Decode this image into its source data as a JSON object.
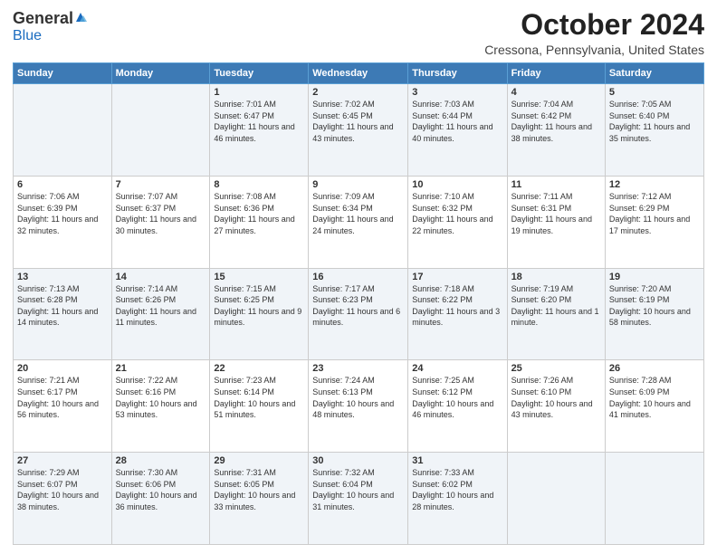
{
  "header": {
    "logo_general": "General",
    "logo_blue": "Blue",
    "main_title": "October 2024",
    "subtitle": "Cressona, Pennsylvania, United States"
  },
  "days_of_week": [
    "Sunday",
    "Monday",
    "Tuesday",
    "Wednesday",
    "Thursday",
    "Friday",
    "Saturday"
  ],
  "weeks": [
    [
      {
        "day": "",
        "sunrise": "",
        "sunset": "",
        "daylight": ""
      },
      {
        "day": "",
        "sunrise": "",
        "sunset": "",
        "daylight": ""
      },
      {
        "day": "1",
        "sunrise": "Sunrise: 7:01 AM",
        "sunset": "Sunset: 6:47 PM",
        "daylight": "Daylight: 11 hours and 46 minutes."
      },
      {
        "day": "2",
        "sunrise": "Sunrise: 7:02 AM",
        "sunset": "Sunset: 6:45 PM",
        "daylight": "Daylight: 11 hours and 43 minutes."
      },
      {
        "day": "3",
        "sunrise": "Sunrise: 7:03 AM",
        "sunset": "Sunset: 6:44 PM",
        "daylight": "Daylight: 11 hours and 40 minutes."
      },
      {
        "day": "4",
        "sunrise": "Sunrise: 7:04 AM",
        "sunset": "Sunset: 6:42 PM",
        "daylight": "Daylight: 11 hours and 38 minutes."
      },
      {
        "day": "5",
        "sunrise": "Sunrise: 7:05 AM",
        "sunset": "Sunset: 6:40 PM",
        "daylight": "Daylight: 11 hours and 35 minutes."
      }
    ],
    [
      {
        "day": "6",
        "sunrise": "Sunrise: 7:06 AM",
        "sunset": "Sunset: 6:39 PM",
        "daylight": "Daylight: 11 hours and 32 minutes."
      },
      {
        "day": "7",
        "sunrise": "Sunrise: 7:07 AM",
        "sunset": "Sunset: 6:37 PM",
        "daylight": "Daylight: 11 hours and 30 minutes."
      },
      {
        "day": "8",
        "sunrise": "Sunrise: 7:08 AM",
        "sunset": "Sunset: 6:36 PM",
        "daylight": "Daylight: 11 hours and 27 minutes."
      },
      {
        "day": "9",
        "sunrise": "Sunrise: 7:09 AM",
        "sunset": "Sunset: 6:34 PM",
        "daylight": "Daylight: 11 hours and 24 minutes."
      },
      {
        "day": "10",
        "sunrise": "Sunrise: 7:10 AM",
        "sunset": "Sunset: 6:32 PM",
        "daylight": "Daylight: 11 hours and 22 minutes."
      },
      {
        "day": "11",
        "sunrise": "Sunrise: 7:11 AM",
        "sunset": "Sunset: 6:31 PM",
        "daylight": "Daylight: 11 hours and 19 minutes."
      },
      {
        "day": "12",
        "sunrise": "Sunrise: 7:12 AM",
        "sunset": "Sunset: 6:29 PM",
        "daylight": "Daylight: 11 hours and 17 minutes."
      }
    ],
    [
      {
        "day": "13",
        "sunrise": "Sunrise: 7:13 AM",
        "sunset": "Sunset: 6:28 PM",
        "daylight": "Daylight: 11 hours and 14 minutes."
      },
      {
        "day": "14",
        "sunrise": "Sunrise: 7:14 AM",
        "sunset": "Sunset: 6:26 PM",
        "daylight": "Daylight: 11 hours and 11 minutes."
      },
      {
        "day": "15",
        "sunrise": "Sunrise: 7:15 AM",
        "sunset": "Sunset: 6:25 PM",
        "daylight": "Daylight: 11 hours and 9 minutes."
      },
      {
        "day": "16",
        "sunrise": "Sunrise: 7:17 AM",
        "sunset": "Sunset: 6:23 PM",
        "daylight": "Daylight: 11 hours and 6 minutes."
      },
      {
        "day": "17",
        "sunrise": "Sunrise: 7:18 AM",
        "sunset": "Sunset: 6:22 PM",
        "daylight": "Daylight: 11 hours and 3 minutes."
      },
      {
        "day": "18",
        "sunrise": "Sunrise: 7:19 AM",
        "sunset": "Sunset: 6:20 PM",
        "daylight": "Daylight: 11 hours and 1 minute."
      },
      {
        "day": "19",
        "sunrise": "Sunrise: 7:20 AM",
        "sunset": "Sunset: 6:19 PM",
        "daylight": "Daylight: 10 hours and 58 minutes."
      }
    ],
    [
      {
        "day": "20",
        "sunrise": "Sunrise: 7:21 AM",
        "sunset": "Sunset: 6:17 PM",
        "daylight": "Daylight: 10 hours and 56 minutes."
      },
      {
        "day": "21",
        "sunrise": "Sunrise: 7:22 AM",
        "sunset": "Sunset: 6:16 PM",
        "daylight": "Daylight: 10 hours and 53 minutes."
      },
      {
        "day": "22",
        "sunrise": "Sunrise: 7:23 AM",
        "sunset": "Sunset: 6:14 PM",
        "daylight": "Daylight: 10 hours and 51 minutes."
      },
      {
        "day": "23",
        "sunrise": "Sunrise: 7:24 AM",
        "sunset": "Sunset: 6:13 PM",
        "daylight": "Daylight: 10 hours and 48 minutes."
      },
      {
        "day": "24",
        "sunrise": "Sunrise: 7:25 AM",
        "sunset": "Sunset: 6:12 PM",
        "daylight": "Daylight: 10 hours and 46 minutes."
      },
      {
        "day": "25",
        "sunrise": "Sunrise: 7:26 AM",
        "sunset": "Sunset: 6:10 PM",
        "daylight": "Daylight: 10 hours and 43 minutes."
      },
      {
        "day": "26",
        "sunrise": "Sunrise: 7:28 AM",
        "sunset": "Sunset: 6:09 PM",
        "daylight": "Daylight: 10 hours and 41 minutes."
      }
    ],
    [
      {
        "day": "27",
        "sunrise": "Sunrise: 7:29 AM",
        "sunset": "Sunset: 6:07 PM",
        "daylight": "Daylight: 10 hours and 38 minutes."
      },
      {
        "day": "28",
        "sunrise": "Sunrise: 7:30 AM",
        "sunset": "Sunset: 6:06 PM",
        "daylight": "Daylight: 10 hours and 36 minutes."
      },
      {
        "day": "29",
        "sunrise": "Sunrise: 7:31 AM",
        "sunset": "Sunset: 6:05 PM",
        "daylight": "Daylight: 10 hours and 33 minutes."
      },
      {
        "day": "30",
        "sunrise": "Sunrise: 7:32 AM",
        "sunset": "Sunset: 6:04 PM",
        "daylight": "Daylight: 10 hours and 31 minutes."
      },
      {
        "day": "31",
        "sunrise": "Sunrise: 7:33 AM",
        "sunset": "Sunset: 6:02 PM",
        "daylight": "Daylight: 10 hours and 28 minutes."
      },
      {
        "day": "",
        "sunrise": "",
        "sunset": "",
        "daylight": ""
      },
      {
        "day": "",
        "sunrise": "",
        "sunset": "",
        "daylight": ""
      }
    ]
  ]
}
